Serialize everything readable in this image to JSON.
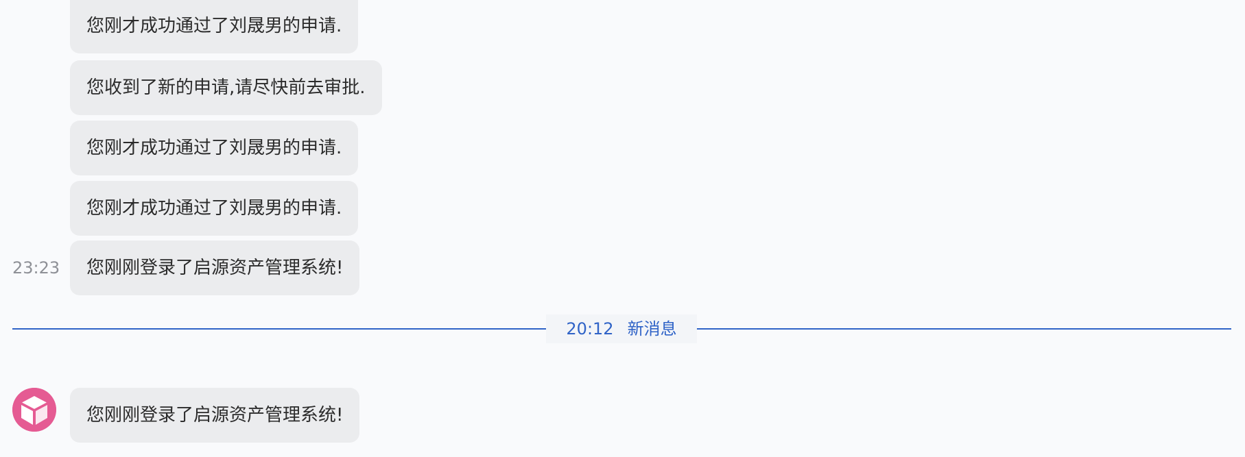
{
  "messages": [
    {
      "text": "您刚才成功通过了刘晟男的申请.",
      "time": ""
    },
    {
      "text": "您收到了新的申请,请尽快前去审批.",
      "time": ""
    },
    {
      "text": "您刚才成功通过了刘晟男的申请.",
      "time": ""
    },
    {
      "text": "您刚才成功通过了刘晟男的申请.",
      "time": ""
    },
    {
      "text": "您刚刚登录了启源资产管理系统!",
      "time": "23:23"
    }
  ],
  "divider": {
    "time": "20:12",
    "label": "新消息"
  },
  "new_messages": [
    {
      "text": "您刚刚登录了启源资产管理系统!",
      "avatar_icon": "cube-icon"
    }
  ],
  "colors": {
    "accent": "#2f63c7",
    "avatar": "#e55b93",
    "bubble": "#ebecee",
    "background": "#f9fafc"
  }
}
